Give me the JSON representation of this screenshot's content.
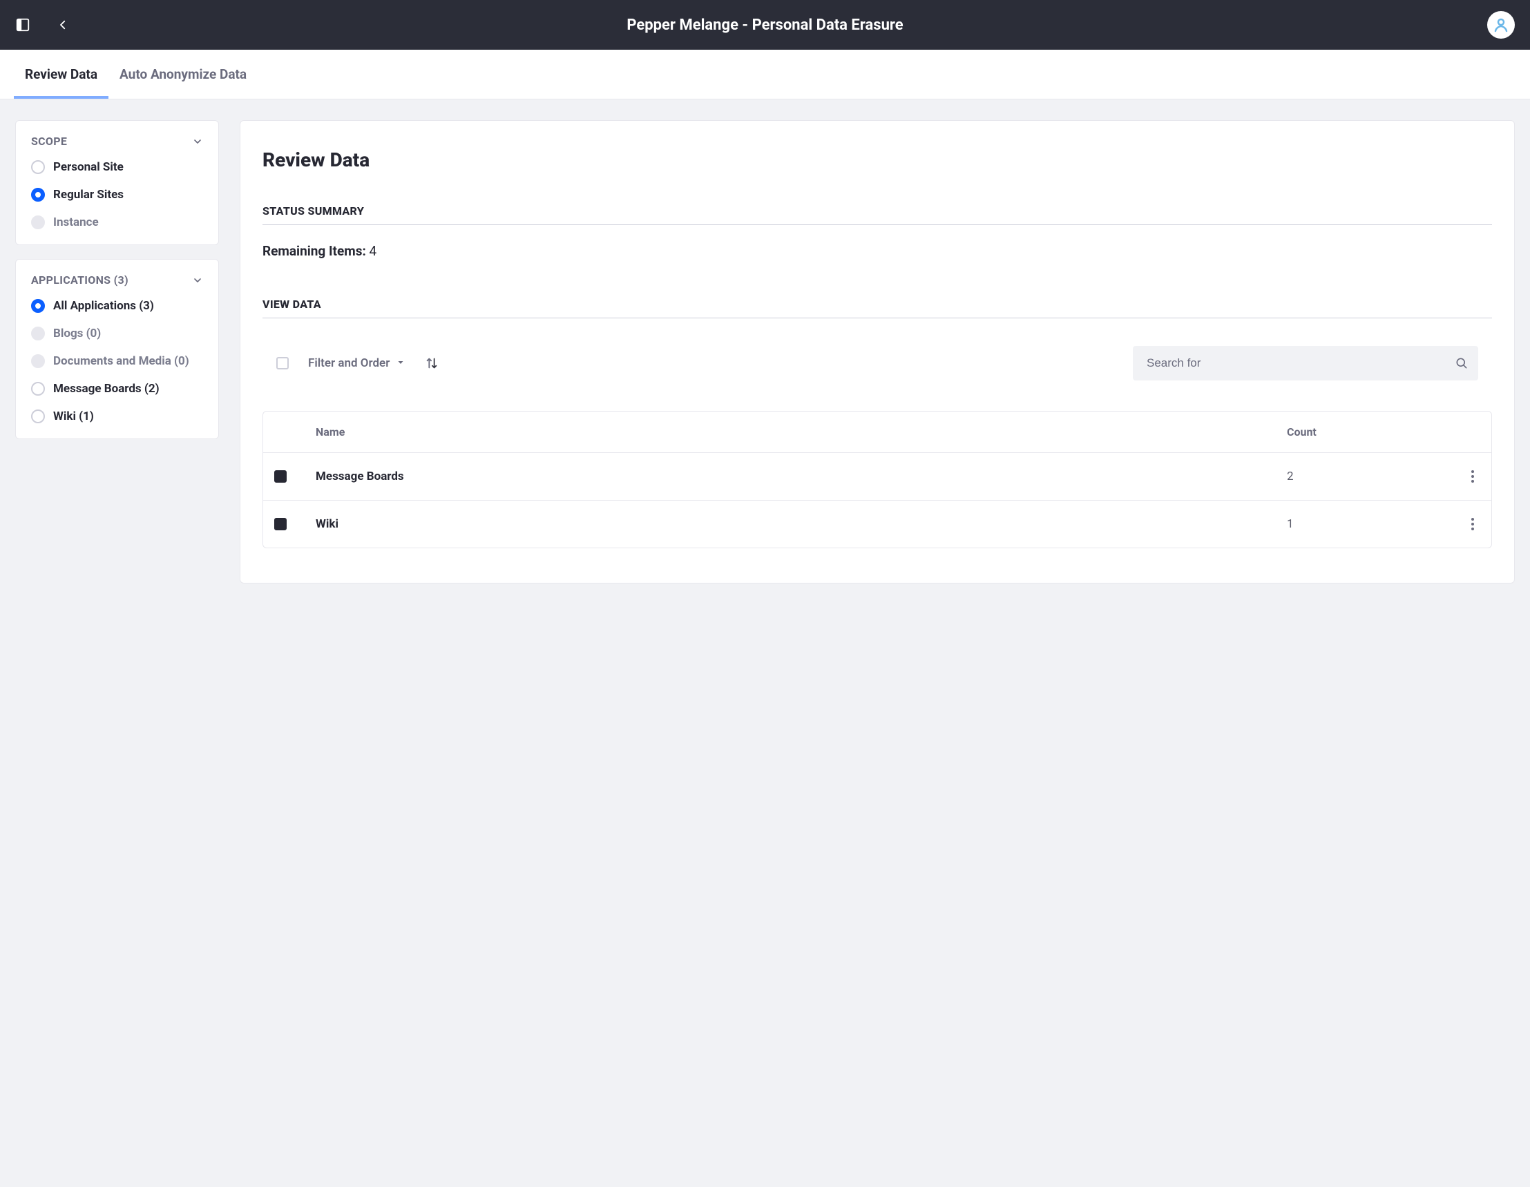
{
  "header": {
    "title": "Pepper Melange - Personal Data Erasure"
  },
  "tabs": [
    {
      "label": "Review Data",
      "active": true
    },
    {
      "label": "Auto Anonymize Data",
      "active": false
    }
  ],
  "scope_panel": {
    "title": "SCOPE",
    "items": [
      {
        "label": "Personal Site",
        "selected": false,
        "disabled": false
      },
      {
        "label": "Regular Sites",
        "selected": true,
        "disabled": false
      },
      {
        "label": "Instance",
        "selected": false,
        "disabled": true
      }
    ]
  },
  "applications_panel": {
    "title": "APPLICATIONS (3)",
    "items": [
      {
        "label": "All Applications (3)",
        "selected": true,
        "disabled": false
      },
      {
        "label": "Blogs (0)",
        "selected": false,
        "disabled": true
      },
      {
        "label": "Documents and Media (0)",
        "selected": false,
        "disabled": true
      },
      {
        "label": "Message Boards (2)",
        "selected": false,
        "disabled": false
      },
      {
        "label": "Wiki (1)",
        "selected": false,
        "disabled": false
      }
    ]
  },
  "main": {
    "heading": "Review Data",
    "status_summary_title": "STATUS SUMMARY",
    "remaining_label": "Remaining Items:",
    "remaining_value": "4",
    "view_data_title": "VIEW DATA",
    "filter_order_label": "Filter and Order",
    "search_placeholder": "Search for",
    "columns": {
      "name": "Name",
      "count": "Count"
    },
    "rows": [
      {
        "name": "Message Boards",
        "count": "2"
      },
      {
        "name": "Wiki",
        "count": "1"
      }
    ]
  }
}
